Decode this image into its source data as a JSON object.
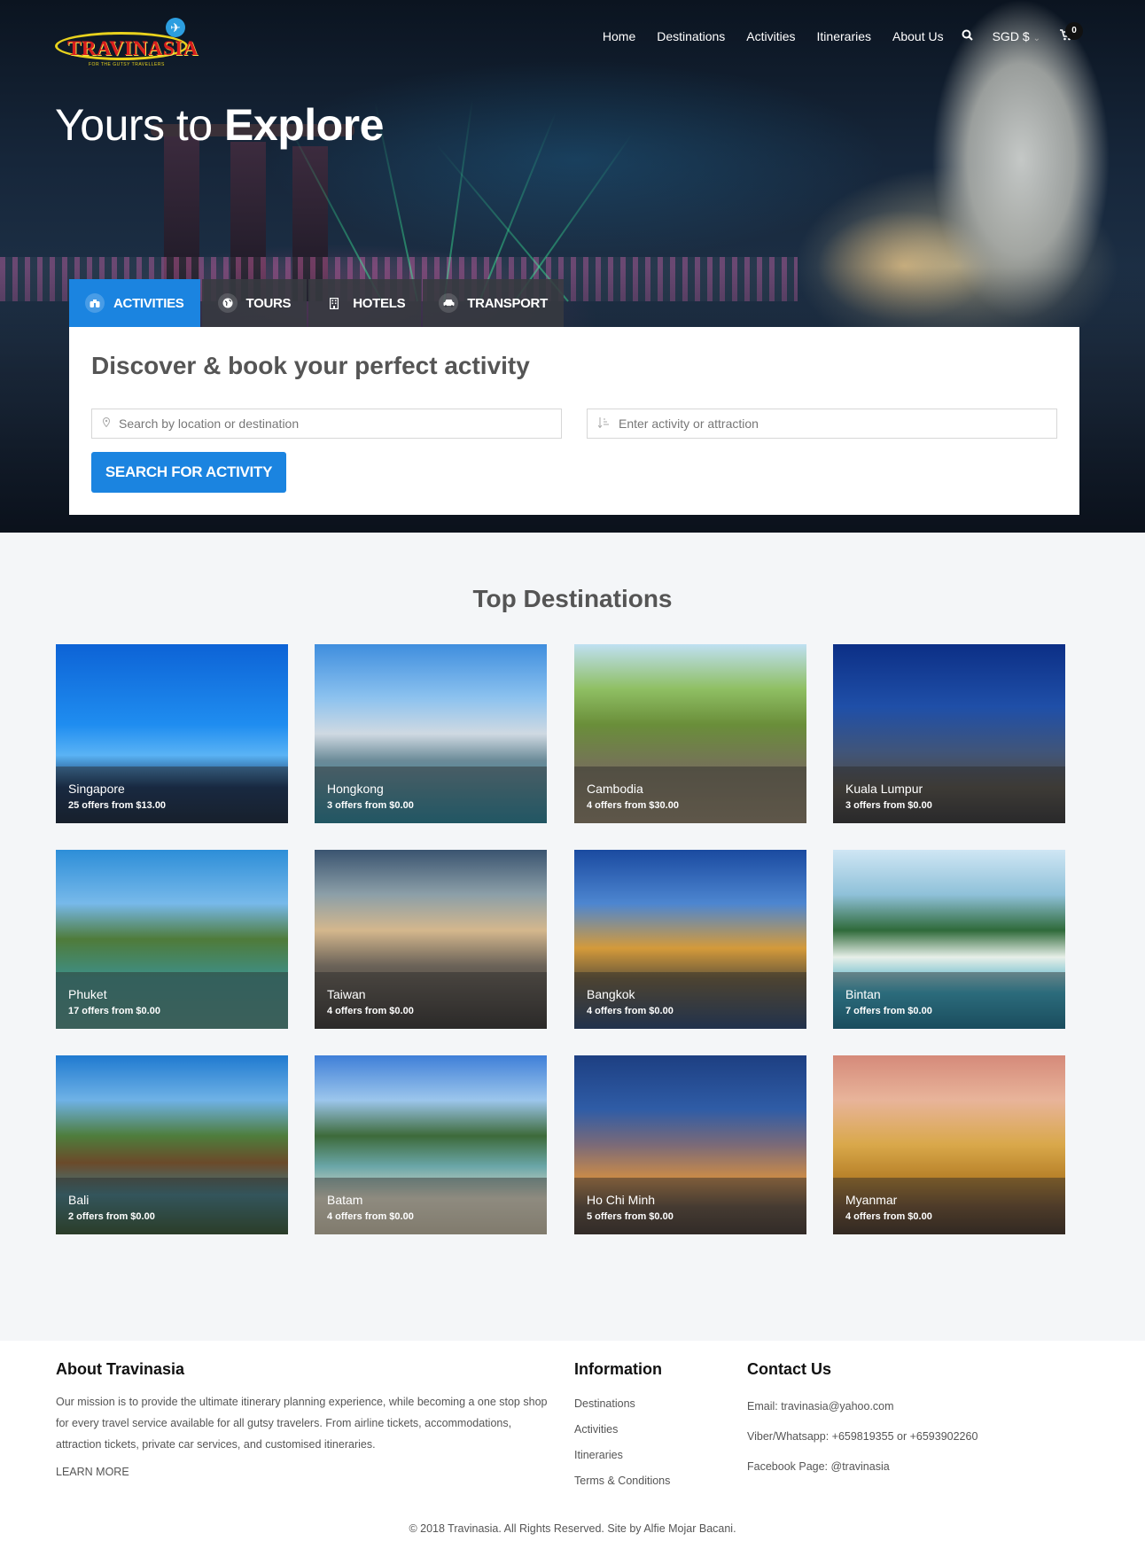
{
  "brand": {
    "name": "TRAVINASIA",
    "tagline": "FOR THE GUTSY TRAVELLERS"
  },
  "nav": {
    "items": [
      "Home",
      "Destinations",
      "Activities",
      "Itineraries",
      "About Us"
    ],
    "currency": "SGD $",
    "cart_count": "0"
  },
  "hero": {
    "title_light": "Yours to",
    "title_bold": "Explore"
  },
  "tabs": [
    {
      "label": "ACTIVITIES",
      "icon": "binoculars-icon",
      "active": true
    },
    {
      "label": "TOURS",
      "icon": "globe-icon",
      "active": false
    },
    {
      "label": "HOTELS",
      "icon": "building-icon",
      "active": false
    },
    {
      "label": "TRANSPORT",
      "icon": "car-icon",
      "active": false
    }
  ],
  "search": {
    "heading": "Discover & book your perfect activity",
    "location_placeholder": "Search by location or destination",
    "activity_placeholder": "Enter activity or attraction",
    "button_label": "SEARCH FOR ACTIVITY"
  },
  "destinations": {
    "title": "Top Destinations",
    "items": [
      {
        "name": "Singapore",
        "offers": "25 offers from $13.00"
      },
      {
        "name": "Hongkong",
        "offers": "3 offers from $0.00"
      },
      {
        "name": "Cambodia",
        "offers": "4 offers from $30.00"
      },
      {
        "name": "Kuala Lumpur",
        "offers": "3 offers from $0.00"
      },
      {
        "name": "Phuket",
        "offers": "17 offers from $0.00"
      },
      {
        "name": "Taiwan",
        "offers": "4 offers from $0.00"
      },
      {
        "name": "Bangkok",
        "offers": "4 offers from $0.00"
      },
      {
        "name": "Bintan",
        "offers": "7 offers from $0.00"
      },
      {
        "name": "Bali",
        "offers": "2 offers from $0.00"
      },
      {
        "name": "Batam",
        "offers": "4 offers from $0.00"
      },
      {
        "name": "Ho Chi Minh",
        "offers": "5 offers from $0.00"
      },
      {
        "name": "Myanmar",
        "offers": "4 offers from $0.00"
      }
    ]
  },
  "footer": {
    "about_title": "About Travinasia",
    "about_text": "Our mission is to provide the ultimate itinerary planning experience, while becoming a one stop shop for every travel service available for all gutsy travelers. From airline tickets, accommodations, attraction tickets, private car services, and customised itineraries.",
    "learn_more": "LEARN MORE",
    "info_title": "Information",
    "info_links": [
      "Destinations",
      "Activities",
      "Itineraries",
      "Terms & Conditions"
    ],
    "contact_title": "Contact Us",
    "contact_email": "Email: travinasia@yahoo.com",
    "contact_phone": "Viber/Whatsapp: +659819355 or +6593902260",
    "contact_facebook": "Facebook Page: @travinasia",
    "copyright": "© 2018 Travinasia. All Rights Reserved. Site by Alfie Mojar Bacani."
  },
  "colors": {
    "accent": "#1b84e0",
    "tab_inactive": "#373a40",
    "heading": "#555555"
  }
}
